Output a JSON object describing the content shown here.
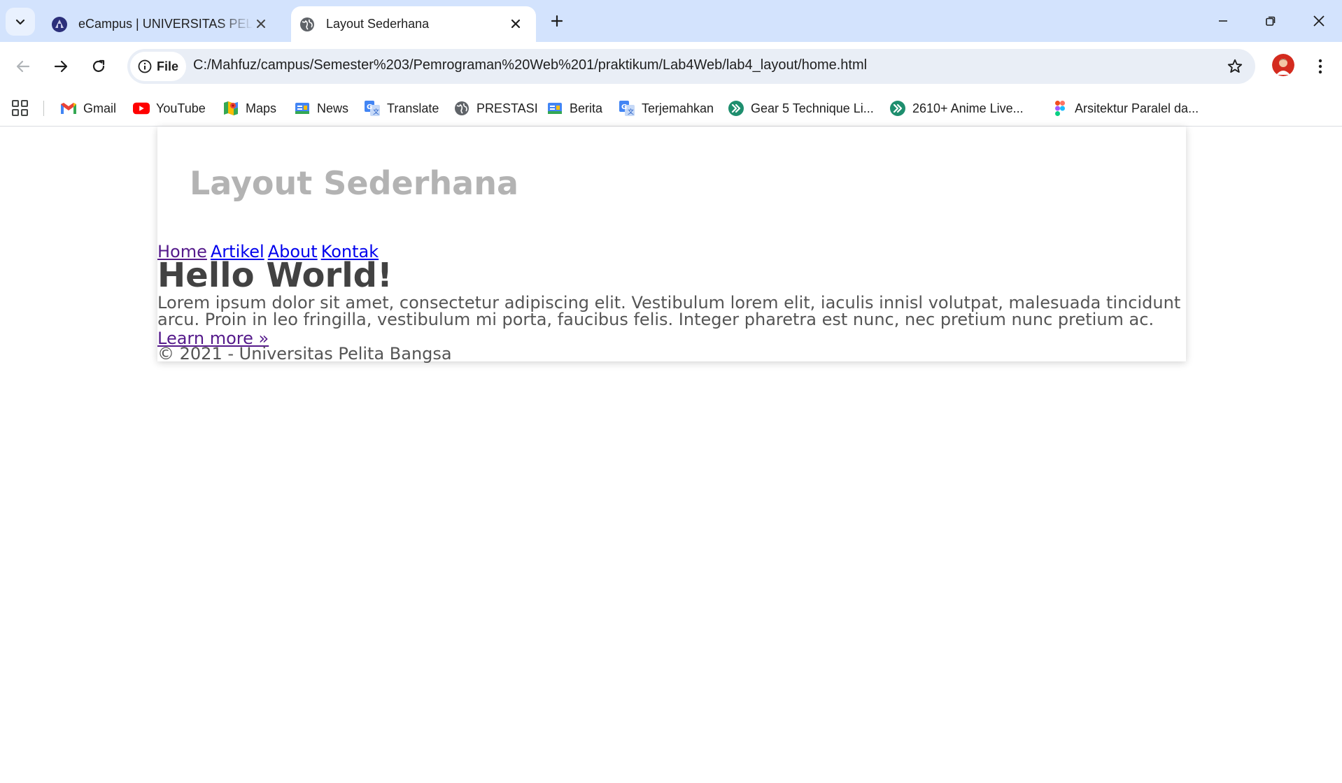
{
  "browser": {
    "tabs": [
      {
        "title": "eCampus | UNIVERSITAS PELITA BANGSA",
        "active": false
      },
      {
        "title": "Layout Sederhana",
        "active": true
      }
    ],
    "address": {
      "scheme_label": "File",
      "url": "C:/Mahfuz/campus/Semester%203/Pemrograman%20Web%201/praktikum/Lab4Web/lab4_layout/home.html"
    },
    "bookmarks": [
      {
        "label": "Gmail",
        "icon": "gmail-icon"
      },
      {
        "label": "YouTube",
        "icon": "youtube-icon"
      },
      {
        "label": "Maps",
        "icon": "maps-icon"
      },
      {
        "label": "News",
        "icon": "news-icon"
      },
      {
        "label": "Translate",
        "icon": "translate-icon"
      },
      {
        "label": "PRESTASI",
        "icon": "globe-icon"
      },
      {
        "label": "Berita",
        "icon": "news-icon"
      },
      {
        "label": "Terjemahkan",
        "icon": "translate-icon"
      },
      {
        "label": "Gear 5 Technique Li...",
        "icon": "arrow-circle-icon"
      },
      {
        "label": "2610+ Anime Live...",
        "icon": "arrow-circle-icon"
      },
      {
        "label": "Arsitektur Paralel da...",
        "icon": "figma-icon"
      }
    ],
    "colors": {
      "tabstrip": "#d3e3fd",
      "omnibox": "#e9eef6",
      "visited_link": "#551a8b",
      "link": "#0000ee"
    }
  },
  "page": {
    "header": "Layout Sederhana",
    "nav": [
      "Home",
      "Artikel",
      "About",
      "Kontak"
    ],
    "hero": {
      "title": "Hello World!",
      "text": "Lorem ipsum dolor sit amet, consectetur adipiscing elit. Vestibulum lorem elit, iaculis innisl volutpat, malesuada tincidunt arcu. Proin in leo fringilla, vestibulum mi porta, faucibus felis. Integer pharetra est nunc, nec pretium nunc pretium ac.",
      "link": "Learn more »"
    },
    "footer": "© 2021 - Universitas Pelita Bangsa"
  }
}
